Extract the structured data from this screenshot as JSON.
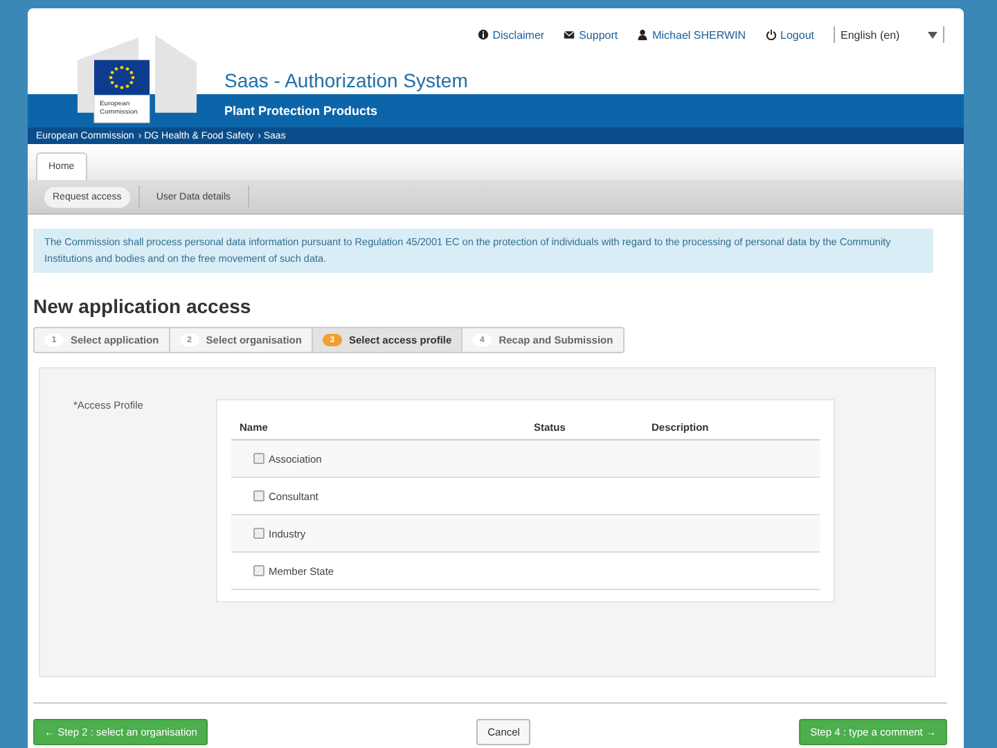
{
  "top_links": [
    {
      "kind": "info",
      "label": "Disclaimer"
    },
    {
      "kind": "mail",
      "label": "Support"
    },
    {
      "kind": "user",
      "label": "Michael SHERWIN"
    },
    {
      "kind": "power",
      "label": "Logout"
    }
  ],
  "language": {
    "value": "English (en)"
  },
  "logo": {
    "line1": "European",
    "line2": "Commission"
  },
  "site_title": "Saas - Authorization System",
  "site_subtitle": "Plant Protection Products",
  "breadcrumb": [
    "European Commission",
    "DG Health & Food Safety",
    "Saas"
  ],
  "breadcrumb_separator": "›",
  "tabs": [
    {
      "label": "Home",
      "selected": true
    }
  ],
  "subnav": [
    {
      "label": "Request access",
      "selected": true
    },
    {
      "label": "User Data details",
      "selected": false
    }
  ],
  "notice": "The Commission shall process personal data information pursuant to Regulation 45/2001 EC on the protection of individuals with regard to the processing of personal data by the Community Institutions and bodies and on the free movement of such data.",
  "heading": "New application access",
  "steps": [
    {
      "number": "1",
      "label": "Select application",
      "selected": false
    },
    {
      "number": "2",
      "label": "Select organisation",
      "selected": false
    },
    {
      "number": "3",
      "label": "Select access profile",
      "selected": true
    },
    {
      "number": "4",
      "label": "Recap and Submission",
      "selected": false
    }
  ],
  "field_label": "*Access Profile",
  "table": {
    "columns": [
      "Name",
      "Status",
      "Description"
    ],
    "rows": [
      {
        "name": "Association",
        "checked": false
      },
      {
        "name": "Consultant",
        "checked": false
      },
      {
        "name": "Industry",
        "checked": false
      },
      {
        "name": "Member State",
        "checked": false
      }
    ]
  },
  "buttons": {
    "back": "← Step 2 : select an organisation",
    "cancel": "Cancel",
    "next": "Step 4 : type a comment →"
  }
}
